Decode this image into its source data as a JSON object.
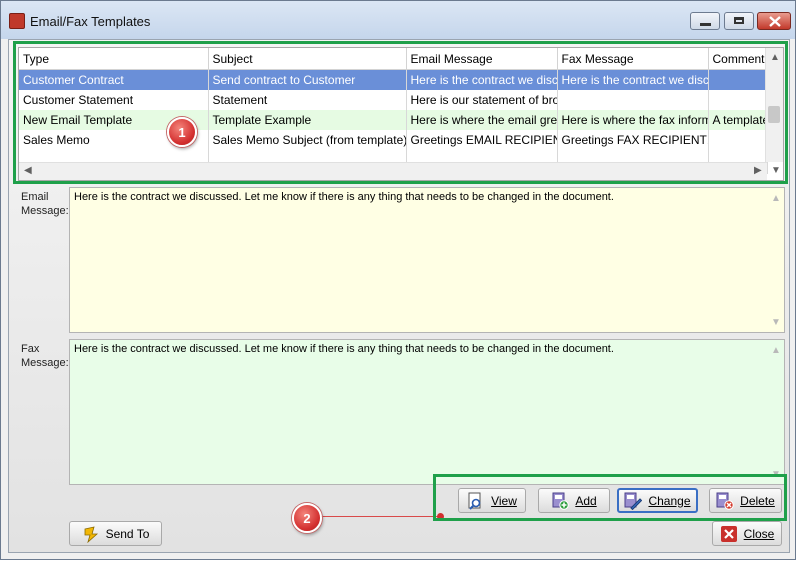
{
  "window": {
    "title": "Email/Fax Templates"
  },
  "grid": {
    "columns": [
      "Type",
      "Subject",
      "Email Message",
      "Fax Message",
      "Comment"
    ],
    "rows": [
      [
        "Customer Contract",
        "Send contract to Customer",
        "Here is the contract we discuss",
        "Here is the contract we discuss",
        ""
      ],
      [
        "Customer Statement",
        "Statement",
        "Here is our statement of broker",
        "",
        ""
      ],
      [
        "New Email Template",
        "Template Example",
        "Here is where the email greeting",
        "Here is where the fax informatio",
        "A template"
      ],
      [
        "Sales Memo",
        "Sales Memo Subject (from template)",
        "Greetings EMAIL RECIPIENT!F",
        "Greetings FAX RECIPIENT!Plea",
        ""
      ]
    ]
  },
  "email": {
    "label_line1": "Email",
    "label_line2": "Message:",
    "text": "Here is the contract we discussed.  Let me know if there is any thing that needs to be changed in the document."
  },
  "fax": {
    "label_line1": "Fax",
    "label_line2": "Message:",
    "text": "Here is the contract we discussed.  Let me know if there is any thing that needs to be changed in the document."
  },
  "buttons": {
    "view": "View",
    "add": "Add",
    "change": "Change",
    "delete": "Delete",
    "send_to": "Send To",
    "close": "Close"
  },
  "callouts": {
    "one": "1",
    "two": "2"
  },
  "colors": {
    "selected_row": "#6a8fd8",
    "alt_row": "#e6fbe3",
    "email_bg": "#ffffe4",
    "fax_bg": "#e8fde8",
    "highlight": "#1fa04a",
    "badge": "#d32f2f"
  }
}
